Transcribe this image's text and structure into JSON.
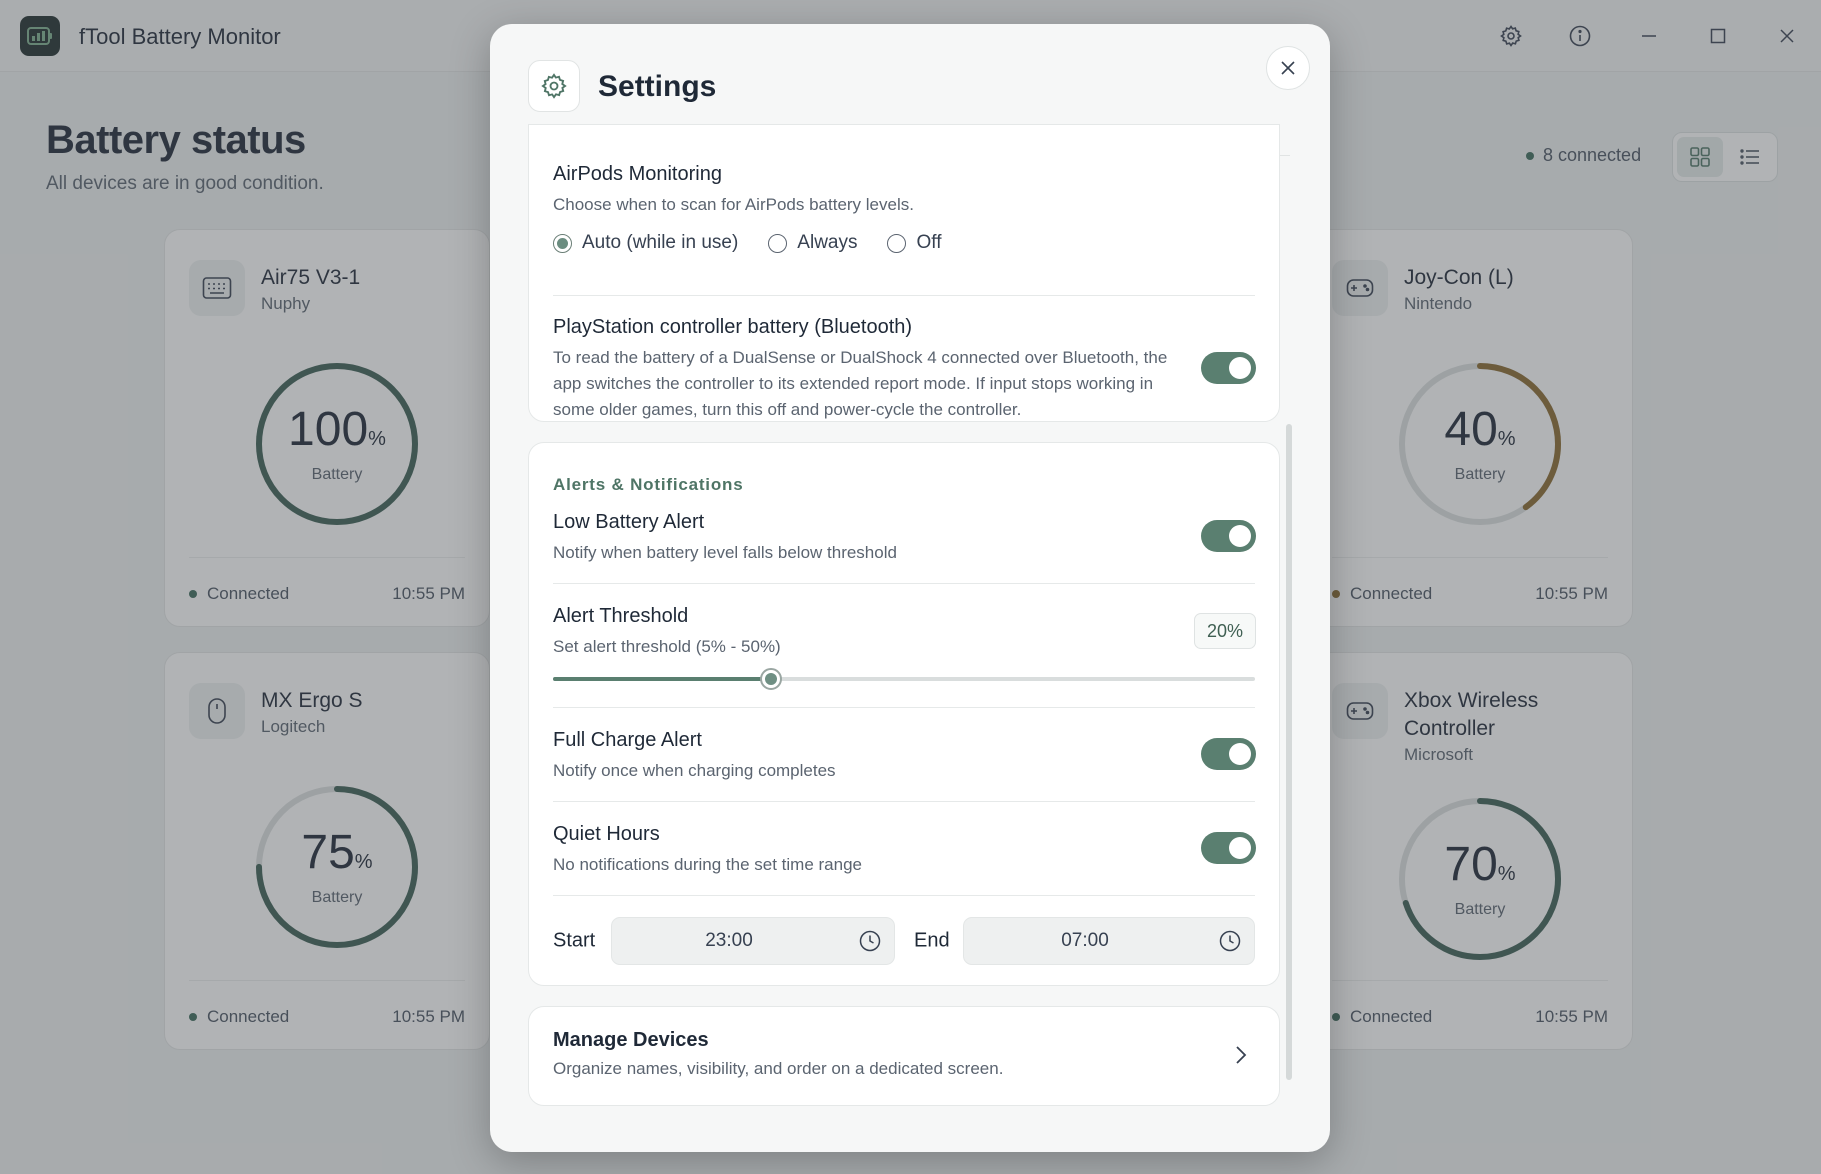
{
  "app": {
    "title": "fTool Battery Monitor"
  },
  "page": {
    "title": "Battery status",
    "subtitle": "All devices are in good condition.",
    "connected_count": "8 connected"
  },
  "devices": [
    {
      "name": "Air75 V3-1",
      "brand": "Nuphy",
      "icon": "keyboard-icon",
      "battery": 100,
      "unit": "%",
      "label": "Battery",
      "status": "Connected",
      "time": "10:55 PM",
      "color": "#3d5f55"
    },
    {
      "name": "Joy-Con (L)",
      "brand": "Nintendo",
      "icon": "gamepad-icon",
      "battery": 40,
      "unit": "%",
      "label": "Battery",
      "status": "Connected",
      "time": "10:55 PM",
      "color": "#8a6a30"
    },
    {
      "name": "MX Ergo S",
      "brand": "Logitech",
      "icon": "mouse-icon",
      "battery": 75,
      "unit": "%",
      "label": "Battery",
      "status": "Connected",
      "time": "10:55 PM",
      "color": "#3d5f55"
    },
    {
      "name": "Xbox Wireless Controller",
      "brand": "Microsoft",
      "icon": "gamepad-icon",
      "battery": 70,
      "unit": "%",
      "label": "Battery",
      "status": "Connected",
      "time": "10:55 PM",
      "color": "#3d5f55"
    }
  ],
  "settings": {
    "title": "Settings",
    "airpods": {
      "title": "AirPods Monitoring",
      "desc": "Choose when to scan for AirPods battery levels.",
      "options": [
        "Auto (while in use)",
        "Always",
        "Off"
      ],
      "selected": "Auto (while in use)"
    },
    "playstation": {
      "title": "PlayStation controller battery (Bluetooth)",
      "desc": "To read the battery of a DualSense or DualShock 4 connected over Bluetooth, the app switches the controller to its extended report mode. If input stops working in some older games, turn this off and power-cycle the controller.",
      "enabled": true
    },
    "alerts": {
      "section_label": "Alerts & Notifications",
      "low_battery": {
        "title": "Low Battery Alert",
        "desc": "Notify when battery level falls below threshold",
        "enabled": true
      },
      "threshold": {
        "title": "Alert Threshold",
        "desc": "Set alert threshold (5% - 50%)",
        "value_label": "20%",
        "value": 20,
        "min": 5,
        "max": 50
      },
      "full_charge": {
        "title": "Full Charge Alert",
        "desc": "Notify once when charging completes",
        "enabled": true
      },
      "quiet_hours": {
        "title": "Quiet Hours",
        "desc": "No notifications during the set time range",
        "enabled": true
      },
      "start_label": "Start",
      "start_time": "23:00",
      "end_label": "End",
      "end_time": "07:00"
    },
    "manage": {
      "title": "Manage Devices",
      "desc": "Organize names, visibility, and order on a dedicated screen."
    }
  },
  "colors": {
    "accent": "#5a7f70",
    "status_ok": "#3d6b5c",
    "status_warn": "#8a6a30"
  }
}
